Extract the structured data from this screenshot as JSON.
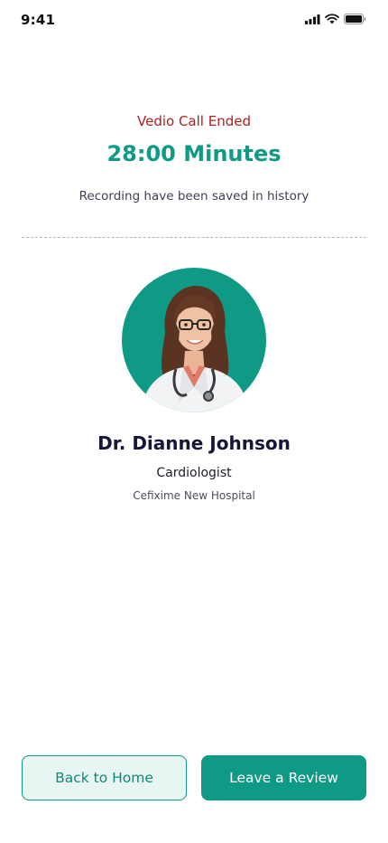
{
  "status_bar": {
    "time": "9:41",
    "icons": [
      "signal-icon",
      "wifi-icon",
      "battery-icon"
    ]
  },
  "call": {
    "status": "Vedio Call Ended",
    "duration": "28:00 Minutes",
    "recording_note": "Recording have been saved in history"
  },
  "doctor": {
    "name": "Dr. Dianne Johnson",
    "specialty": "Cardiologist",
    "hospital": "Cefixime New Hospital"
  },
  "actions": {
    "back_home_label": "Back to Home",
    "leave_review_label": "Leave a Review"
  },
  "colors": {
    "accent": "#0f9a85",
    "alert": "#b21e1e",
    "accent_light_bg": "#e8f6f3"
  }
}
